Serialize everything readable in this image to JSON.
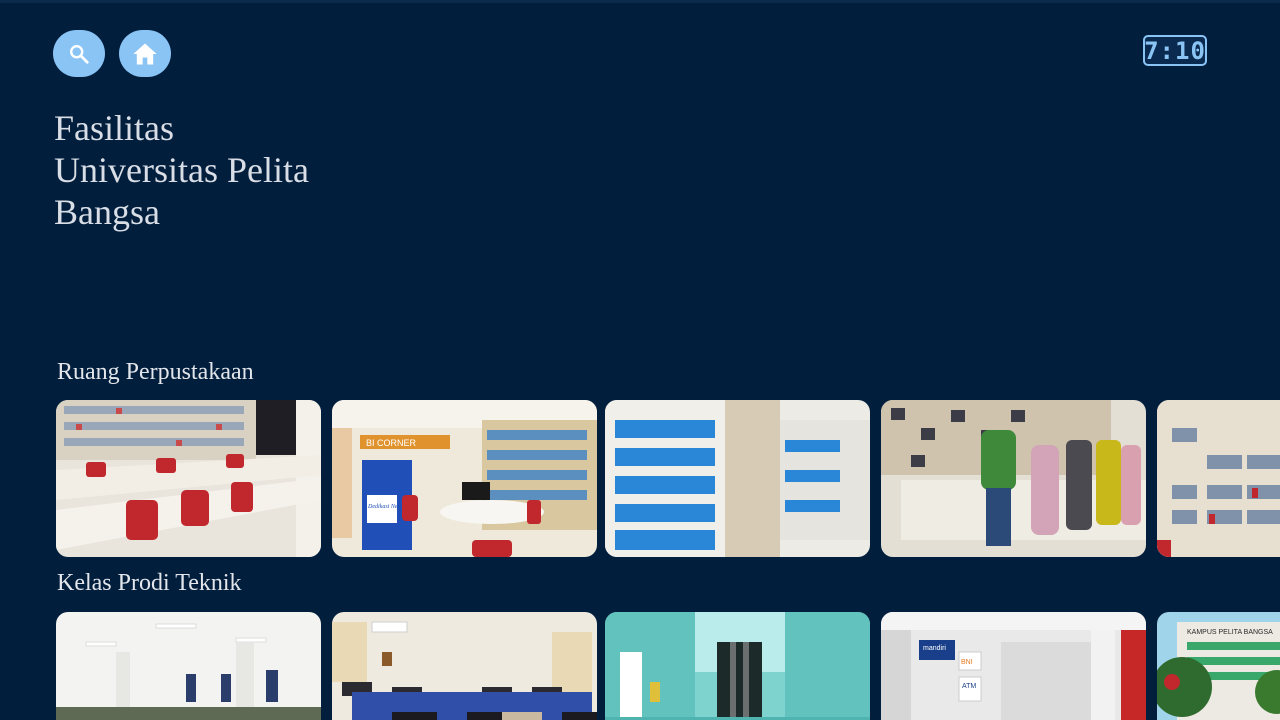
{
  "header": {
    "search_icon": "search-icon",
    "home_icon": "home-icon",
    "clock": "7:10"
  },
  "page": {
    "title_lines": [
      "Fasilitas",
      "Universitas Pelita",
      "Bangsa"
    ]
  },
  "rows": [
    {
      "label": "Ruang Perpustakaan",
      "cards": [
        "library-reading-tables",
        "library-bi-corner",
        "library-blue-archive-shelves",
        "library-locker-counter",
        "library-book-shelves"
      ],
      "card1_poster": "Dedikasi Negeri",
      "card2_sign": "BI CORNER"
    },
    {
      "label": "Kelas Prodi Teknik",
      "cards": [
        "white-hall",
        "computer-lab",
        "escalator-lobby",
        "atm-center",
        "campus-building"
      ],
      "atm_brands": [
        "mandiri",
        "BNI",
        "ATM"
      ],
      "building_sign": "KAMPUS PELITA BANGSA"
    }
  ],
  "colors": {
    "background": "#011e3d",
    "accent": "#8ac4f5",
    "title_text": "#d9dee6"
  }
}
